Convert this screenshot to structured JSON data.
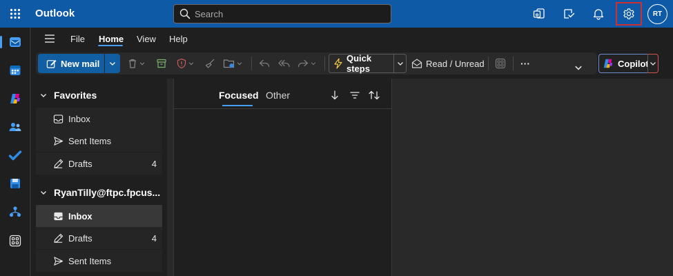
{
  "app": {
    "title": "Outlook"
  },
  "search": {
    "placeholder": "Search"
  },
  "header": {
    "icons": [
      "teams-outlook-icon",
      "my-day-icon",
      "notifications-bell-icon",
      "settings-gear-icon"
    ],
    "avatar_initials": "RT"
  },
  "rail": {
    "items": [
      "mail",
      "calendar",
      "copilot",
      "people",
      "to-do",
      "onedrive-save",
      "org-explorer",
      "more-apps"
    ]
  },
  "menu": {
    "tabs": [
      {
        "label": "File"
      },
      {
        "label": "Home"
      },
      {
        "label": "View"
      },
      {
        "label": "Help"
      }
    ],
    "active": "Home"
  },
  "ribbon": {
    "new_mail": "New mail",
    "quick_steps": "Quick steps",
    "read_unread": "Read / Unread",
    "more": "···",
    "copilot": "Copilot"
  },
  "folders": {
    "favorites_label": "Favorites",
    "favorites": [
      {
        "label": "Inbox",
        "count": ""
      },
      {
        "label": "Sent Items",
        "count": ""
      },
      {
        "label": "Drafts",
        "count": "4"
      }
    ],
    "account_label": "RyanTilly@ftpc.fpcus...",
    "account": [
      {
        "label": "Inbox",
        "count": "",
        "selected": true
      },
      {
        "label": "Drafts",
        "count": "4"
      },
      {
        "label": "Sent Items",
        "count": ""
      }
    ]
  },
  "message_list": {
    "tabs": [
      {
        "label": "Focused",
        "active": true
      },
      {
        "label": "Other",
        "active": false
      }
    ]
  },
  "colors": {
    "brand_blue": "#0f5aa7",
    "accent_blue": "#479ef5",
    "highlight_red": "#d32f2f"
  }
}
